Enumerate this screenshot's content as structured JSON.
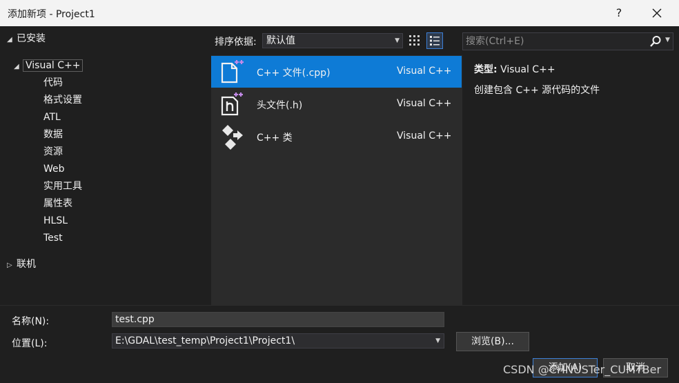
{
  "window": {
    "title": "添加新项 - Project1",
    "help_label": "?"
  },
  "tree": {
    "installed": "已安装",
    "visual_cpp": "Visual C++",
    "children": [
      "代码",
      "格式设置",
      "ATL",
      "数据",
      "资源",
      "Web",
      "实用工具",
      "属性表",
      "HLSL",
      "Test"
    ],
    "online": "联机"
  },
  "sort": {
    "label": "排序依据:",
    "value": "默认值"
  },
  "templates": [
    {
      "name": "C++ 文件(.cpp)",
      "lang": "Visual C++",
      "icon": "cpp-file-icon"
    },
    {
      "name": "头文件(.h)",
      "lang": "Visual C++",
      "icon": "header-file-icon"
    },
    {
      "name": "C++ 类",
      "lang": "Visual C++",
      "icon": "cpp-class-icon"
    }
  ],
  "search": {
    "placeholder": "搜索(Ctrl+E)"
  },
  "details": {
    "type_label": "类型:",
    "type_value": "Visual C++",
    "description": "创建包含 C++ 源代码的文件"
  },
  "form": {
    "name_label": "名称(N):",
    "name_value": "test.cpp",
    "location_label": "位置(L):",
    "location_value": "E:\\GDAL\\test_temp\\Project1\\Project1\\",
    "browse_label": "浏览(B)...",
    "add_label": "添加(A)",
    "cancel_label": "取消"
  },
  "watermark": "CSDN @CHNUSTer_CUMTBer",
  "colors": {
    "accent": "#0e7bd6",
    "background": "#1f1f1f",
    "list_bg": "#2b2b2b",
    "titlebar": "#f3f3f3"
  }
}
